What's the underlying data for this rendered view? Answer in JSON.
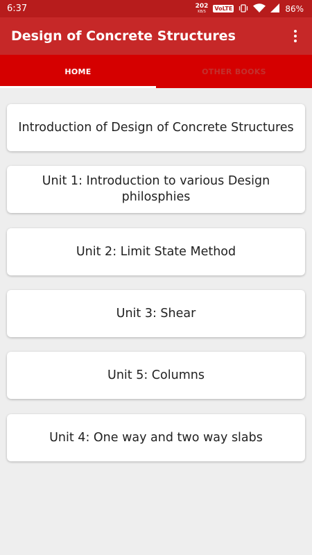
{
  "status_bar": {
    "time": "6:37",
    "net_speed_value": "202",
    "net_speed_unit": "KB/S",
    "volte": "VoLTE",
    "battery": "86%"
  },
  "app_bar": {
    "title": "Design of Concrete Structures",
    "menu_icon": "more-vert-icon"
  },
  "tabs": [
    {
      "label": "HOME",
      "active": true
    },
    {
      "label": "OTHER BOOKS",
      "active": false
    }
  ],
  "chapters": [
    {
      "label": "Introduction of Design of Concrete Structures"
    },
    {
      "label": "Unit 1: Introduction to various Design philosphies"
    },
    {
      "label": "Unit 2: Limit State Method"
    },
    {
      "label": "Unit 3: Shear"
    },
    {
      "label": "Unit 5: Columns"
    },
    {
      "label": "Unit 4: One way and two way slabs"
    }
  ],
  "colors": {
    "status_bar": "#b71c1c",
    "app_bar": "#c62828",
    "tab_bar": "#d50000",
    "background": "#eeeeee"
  }
}
